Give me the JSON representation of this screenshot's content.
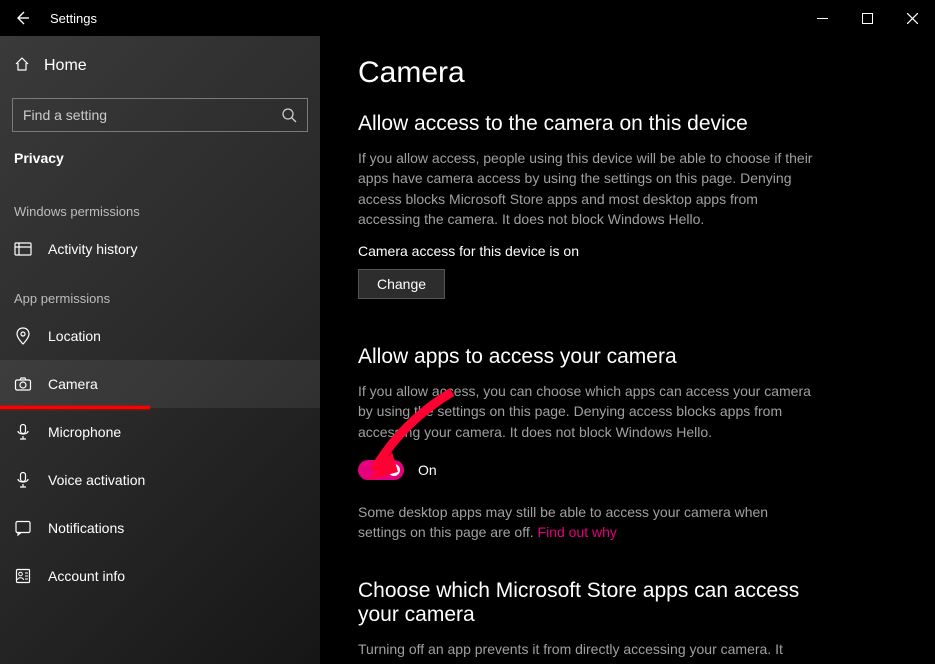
{
  "window": {
    "title": "Settings"
  },
  "sidebar": {
    "home": "Home",
    "search_placeholder": "Find a setting",
    "section": "Privacy",
    "groups": [
      {
        "label": "Windows permissions",
        "items": [
          {
            "id": "activity-history",
            "label": "Activity history"
          }
        ]
      },
      {
        "label": "App permissions",
        "items": [
          {
            "id": "location",
            "label": "Location"
          },
          {
            "id": "camera",
            "label": "Camera",
            "active": true
          },
          {
            "id": "microphone",
            "label": "Microphone"
          },
          {
            "id": "voice-activation",
            "label": "Voice activation"
          },
          {
            "id": "notifications",
            "label": "Notifications"
          },
          {
            "id": "account-info",
            "label": "Account info"
          }
        ]
      }
    ]
  },
  "page": {
    "title": "Camera",
    "section1": {
      "title": "Allow access to the camera on this device",
      "desc": "If you allow access, people using this device will be able to choose if their apps have camera access by using the settings on this page. Denying access blocks Microsoft Store apps and most desktop apps from accessing the camera. It does not block Windows Hello.",
      "status": "Camera access for this device is on",
      "button": "Change"
    },
    "section2": {
      "title": "Allow apps to access your camera",
      "desc": "If you allow access, you can choose which apps can access your camera by using the settings on this page. Denying access blocks apps from accessing your camera. It does not block Windows Hello.",
      "toggle_state": "On",
      "note": "Some desktop apps may still be able to access your camera when settings on this page are off. ",
      "note_link": "Find out why"
    },
    "section3": {
      "title": "Choose which Microsoft Store apps can access your camera",
      "desc_partial": "Turning off an app prevents it from directly accessing your camera. It"
    }
  }
}
